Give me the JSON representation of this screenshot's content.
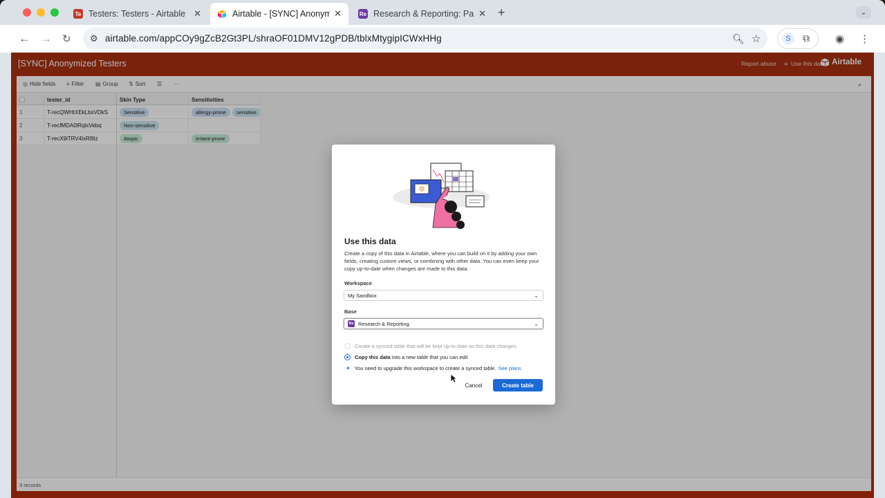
{
  "browser": {
    "tabs": [
      {
        "label": "Testers: Testers - Airtable",
        "favicon_text": "Te",
        "favicon_color": "#c0392b",
        "active": false
      },
      {
        "label": "Airtable - [SYNC] Anonymized",
        "favicon_text": "",
        "favicon_color": "#fcb400",
        "active": true
      },
      {
        "label": "Research & Reporting: Partici",
        "favicon_text": "Re",
        "favicon_color": "#6b3aa0",
        "active": false
      }
    ],
    "new_tab": "+",
    "url": "airtable.com/appCOy9gZcB2Gt3PL/shraOF01DMV12gPDB/tblxMtygipICWxHHg"
  },
  "share_header": {
    "title": "[SYNC] Anonymized Testers",
    "report_abuse": "Report abuse",
    "use_this_data": "Use this data",
    "brand": "Airtable"
  },
  "view_toolbar": {
    "hide_fields": "Hide fields",
    "filter": "Filter",
    "group": "Group",
    "sort": "Sort",
    "more": "···"
  },
  "table": {
    "columns": [
      "tester_id",
      "Skin Type",
      "Sensitivities"
    ],
    "rows": [
      {
        "num": "1",
        "tester_id": "T-recQWHtXEkLbsVDkS",
        "skin_type": "Sensitive",
        "sensitivities": [
          "allergy-prone",
          "sensitive"
        ]
      },
      {
        "num": "2",
        "tester_id": "T-recfMDA0lRqlxVebq",
        "skin_type": "Non-sensitive",
        "sensitivities": []
      },
      {
        "num": "3",
        "tester_id": "T-recX9iTRV4lxRl9iz",
        "skin_type": "Atopic",
        "sensitivities": [
          "irritant-prone"
        ]
      }
    ],
    "record_count": "3 records",
    "pill_colors": {
      "Sensitive": "#cfe0f4",
      "Non-sensitive": "#c9e6f0",
      "Atopic": "#c8ecd9",
      "allergy-prone": "#cfe0f4",
      "sensitive": "#c9e6f0",
      "irritant-prone": "#c8ecd9"
    }
  },
  "dialog": {
    "title": "Use this data",
    "description": "Create a copy of this data in Airtable, where you can build on it by adding your own fields, creating custom views, or combining with other data. You can even keep your copy up-to-date when changes are made to this data.",
    "workspace_label": "Workspace",
    "workspace_value": "My Sandbox",
    "base_label": "Base",
    "base_badge": "Re",
    "base_value": "Research & Reporting",
    "option_sync": "Create a synced table that will be kept up-to-date as this data changes",
    "option_copy_bold": "Copy this data",
    "option_copy_rest": " into a new table that you can edit",
    "upgrade_text": "You need to upgrade this workspace to create a synced table.",
    "upgrade_link": "See plans",
    "cancel": "Cancel",
    "create": "Create table"
  }
}
